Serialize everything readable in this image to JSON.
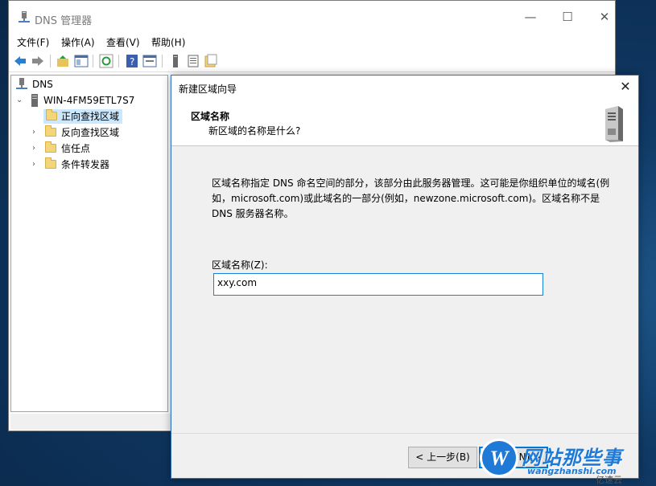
{
  "window": {
    "title": "DNS 管理器",
    "minimize": "—",
    "maximize": "☐",
    "close": "✕"
  },
  "menu": {
    "items": [
      "文件(F)",
      "操作(A)",
      "查看(V)",
      "帮助(H)"
    ]
  },
  "tree": {
    "root": "DNS",
    "server": "WIN-4FM59ETL7S7",
    "children": [
      "正向查找区域",
      "反向查找区域",
      "信任点",
      "条件转发器"
    ],
    "selected": "正向查找区域"
  },
  "dialog": {
    "title": "新建区域向导",
    "close": "✕",
    "header_title": "区域名称",
    "header_subtitle": "新区域的名称是什么?",
    "description": "区域名称指定 DNS 命名空间的部分，该部分由此服务器管理。这可能是你组织单位的域名(例如，microsoft.com)或此域名的一部分(例如，newzone.microsoft.com)。区域名称不是 DNS 服务器名称。",
    "field_label": "区域名称(Z):",
    "field_value": "xxy.com",
    "back_label": "< 上一步(B)",
    "next_label": "下一步(N) >"
  },
  "watermark": {
    "logo_letter": "W",
    "site_name": "网站那些事",
    "url": "wangzhanshi.com",
    "yisu": "亿速云"
  },
  "colors": {
    "accent": "#0078d7",
    "selected_bg": "#cce8ff",
    "folder": "#f5d57a"
  }
}
